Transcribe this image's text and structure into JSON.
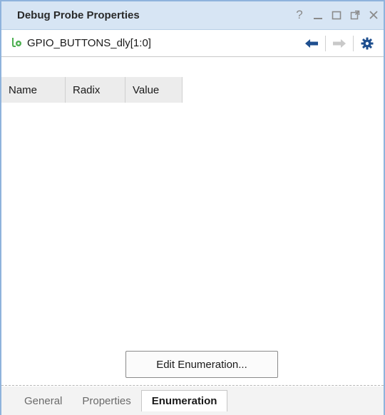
{
  "window": {
    "title": "Debug Probe Properties",
    "controls": [
      "?",
      "minimize",
      "maximize",
      "float",
      "close"
    ]
  },
  "toolbar": {
    "probe_name": "GPIO_BUTTONS_dly[1:0]",
    "probe_icon": "probe-bus-icon",
    "back_icon": "arrow-left-icon",
    "forward_icon": "arrow-right-icon",
    "settings_icon": "gear-icon"
  },
  "table": {
    "columns": [
      "Name",
      "Radix",
      "Value"
    ],
    "rows": []
  },
  "actions": {
    "edit_enumeration_label": "Edit Enumeration..."
  },
  "tabs": [
    {
      "label": "General",
      "active": false
    },
    {
      "label": "Properties",
      "active": false
    },
    {
      "label": "Enumeration",
      "active": true
    }
  ],
  "colors": {
    "titlebar_bg": "#d7e5f4",
    "border_accent": "#8fb3dc",
    "icon_blue": "#1f4f8f",
    "probe_green": "#4caf50"
  }
}
